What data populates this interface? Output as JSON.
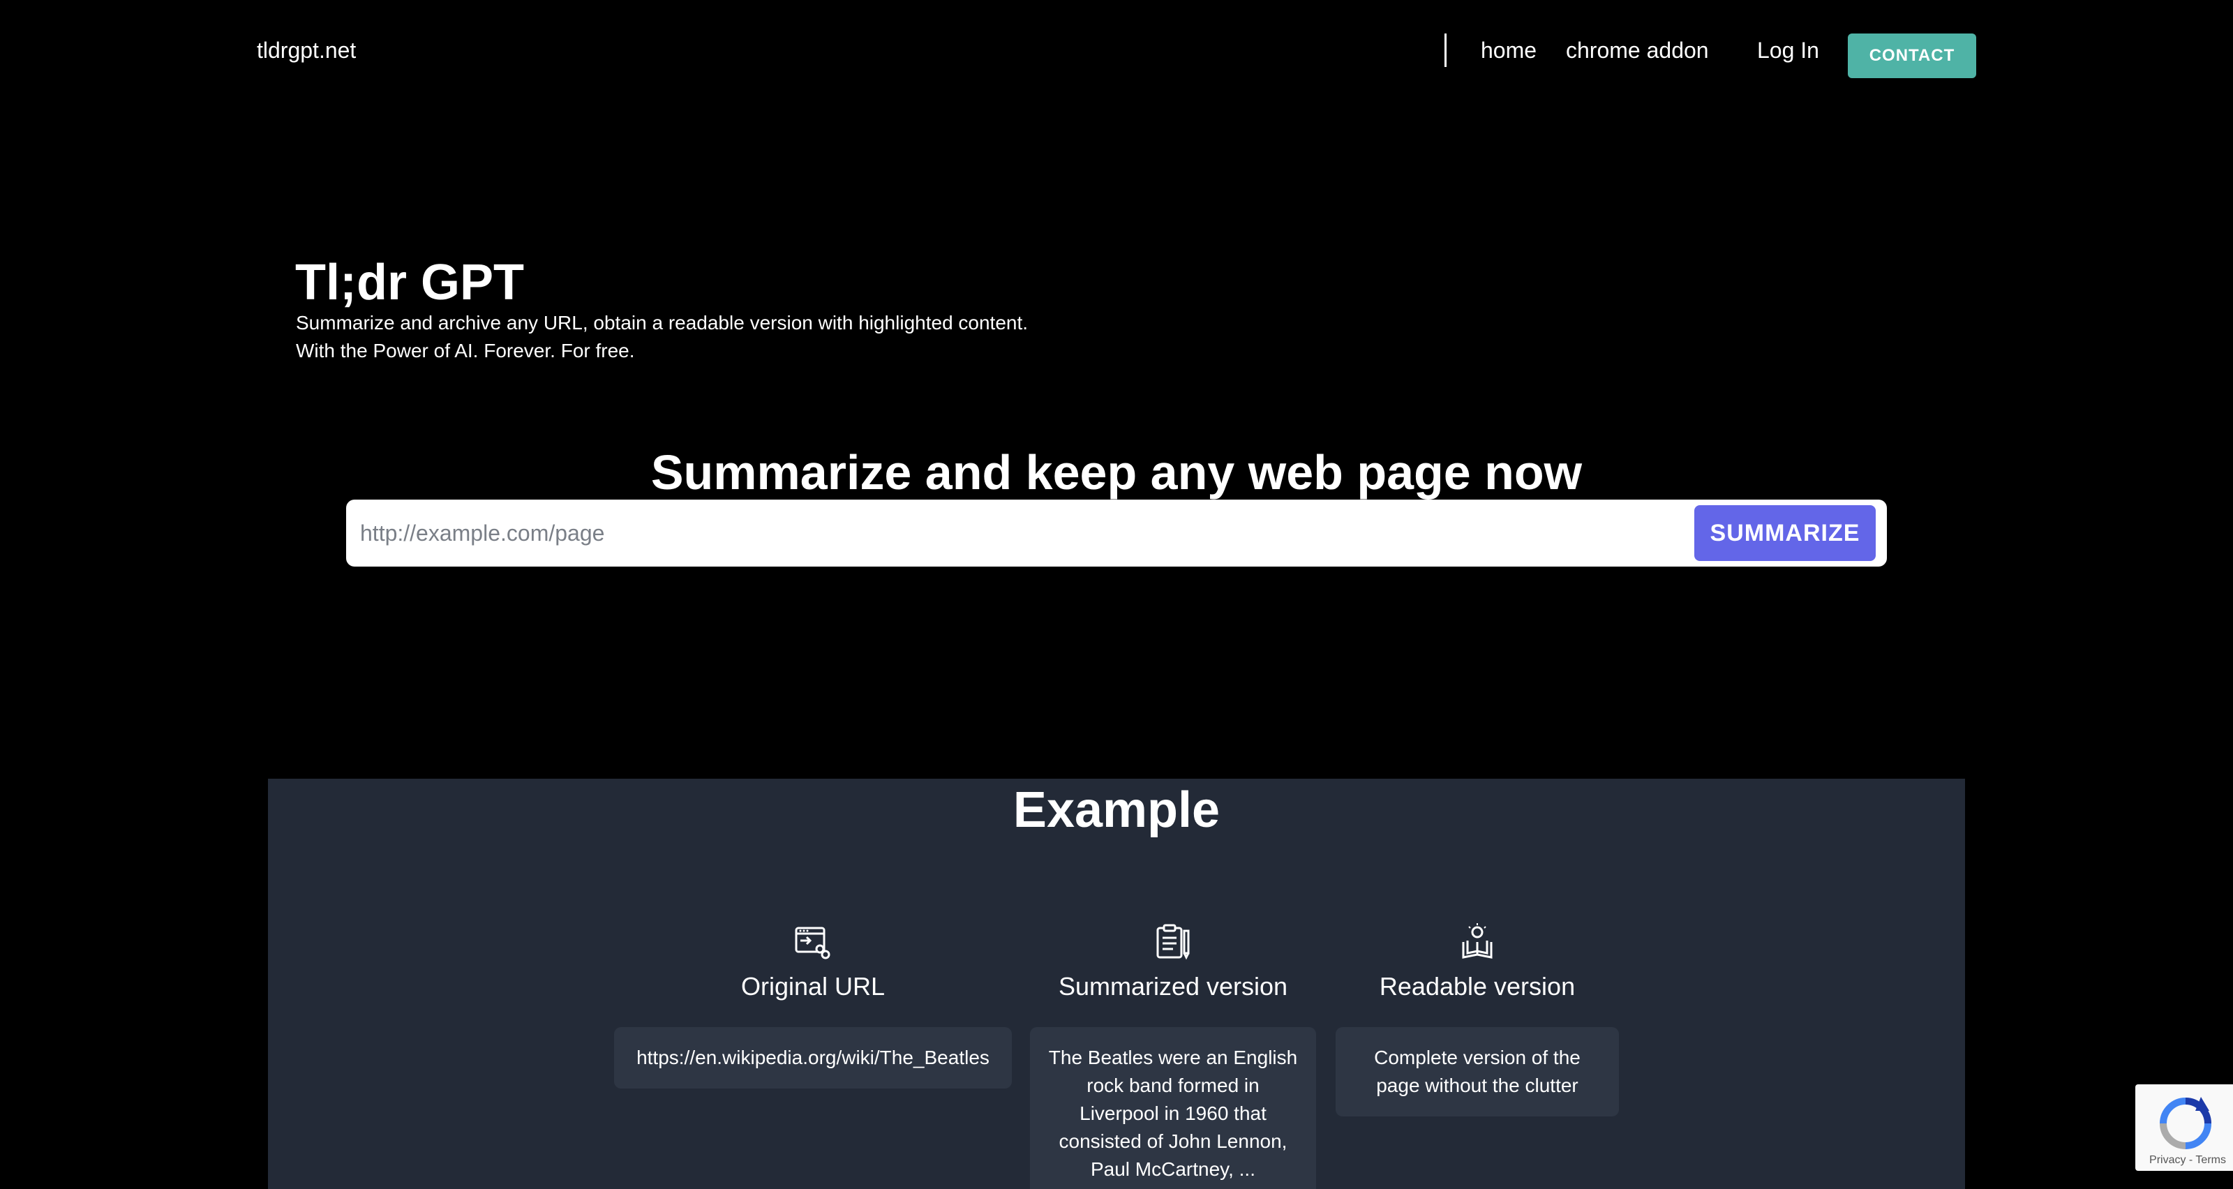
{
  "nav": {
    "brand": "tldrgpt.net",
    "links": [
      "home",
      "chrome addon"
    ],
    "login": "Log In",
    "contact": "CONTACT"
  },
  "hero": {
    "title": "Tl;dr GPT",
    "subtitle_line1": "Summarize and archive any URL, obtain a readable version with highlighted content.",
    "subtitle_line2": "With the Power of AI. Forever. For free."
  },
  "summarize": {
    "heading": "Summarize and keep any web page now",
    "placeholder": "http://example.com/page",
    "button": "SUMMARIZE"
  },
  "example": {
    "heading": "Example",
    "columns": [
      {
        "icon": "browser-link-icon",
        "title": "Original URL",
        "text": "https://en.wikipedia.org/wiki/The_Beatles"
      },
      {
        "icon": "clipboard-pencil-icon",
        "title": "Summarized version",
        "text": "The Beatles were an English rock band formed in Liverpool in 1960 that consisted of John Lennon, Paul McCartney, ..."
      },
      {
        "icon": "reading-idea-icon",
        "title": "Readable version",
        "text": "Complete version of the page without the clutter"
      }
    ]
  },
  "recaptcha": {
    "links": "Privacy - Terms"
  },
  "colors": {
    "background": "#000000",
    "contact_button": "#4fb3a6",
    "summarize_button": "#6366e8",
    "example_panel": "#232a37",
    "card": "#2e3644"
  }
}
